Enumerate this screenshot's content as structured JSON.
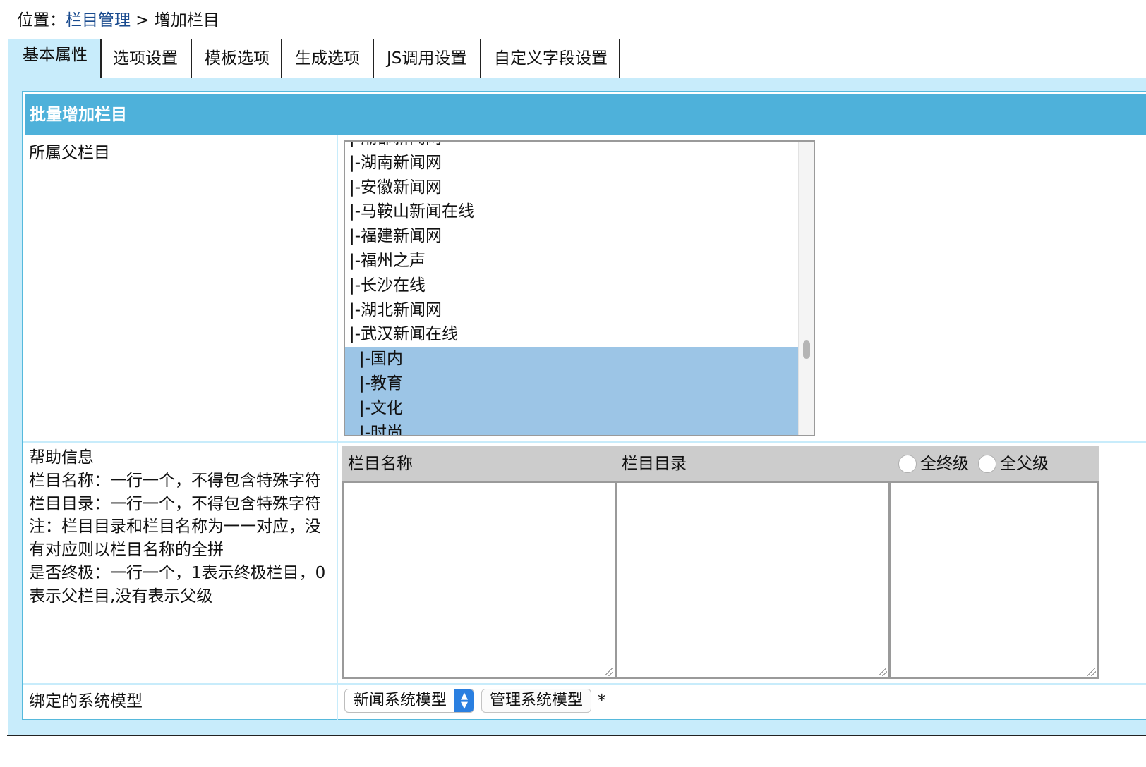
{
  "breadcrumb": {
    "prefix": "位置：",
    "link": "栏目管理",
    "separator": " > ",
    "current": "增加栏目"
  },
  "tabs": [
    {
      "label": "基本属性",
      "active": true
    },
    {
      "label": "选项设置"
    },
    {
      "label": "模板选项"
    },
    {
      "label": "生成选项"
    },
    {
      "label": "JS调用设置"
    },
    {
      "label": "自定义字段设置"
    }
  ],
  "section": {
    "title": "批量增加栏目"
  },
  "parent_field": {
    "label": "所属父栏目",
    "options": [
      {
        "text": "|-潮都新闻网",
        "selected": false,
        "indent": 0
      },
      {
        "text": "|-湖南新闻网",
        "selected": false,
        "indent": 0
      },
      {
        "text": "|-安徽新闻网",
        "selected": false,
        "indent": 0
      },
      {
        "text": "|-马鞍山新闻在线",
        "selected": false,
        "indent": 0
      },
      {
        "text": "|-福建新闻网",
        "selected": false,
        "indent": 0
      },
      {
        "text": "|-福州之声",
        "selected": false,
        "indent": 0
      },
      {
        "text": "|-长沙在线",
        "selected": false,
        "indent": 0
      },
      {
        "text": "|-湖北新闻网",
        "selected": false,
        "indent": 0
      },
      {
        "text": "|-武汉新闻在线",
        "selected": false,
        "indent": 0
      },
      {
        "text": "|-国内",
        "selected": true,
        "indent": 1
      },
      {
        "text": "|-教育",
        "selected": true,
        "indent": 1
      },
      {
        "text": "|-文化",
        "selected": true,
        "indent": 1
      },
      {
        "text": "|-时尚",
        "selected": true,
        "indent": 1
      }
    ]
  },
  "help": {
    "lines": [
      "帮助信息",
      "栏目名称：一行一个，不得包含特殊字符",
      "栏目目录：一行一个，不得包含特殊字符",
      "注：栏目目录和栏目名称为一一对应，没有对应则以栏目名称的全拼",
      "是否终极：一行一个，1表示终极栏目，0表示父栏目,没有表示父级"
    ]
  },
  "batch": {
    "col_name": "栏目名称",
    "col_dir": "栏目目录",
    "radio_all_final": "全终级",
    "radio_all_parent": "全父级",
    "names_value": "",
    "dirs_value": "",
    "final_value": ""
  },
  "model_field": {
    "label": "绑定的系统模型",
    "selected": "新闻系统模型",
    "manage_button": "管理系统模型",
    "required_mark": "*"
  }
}
